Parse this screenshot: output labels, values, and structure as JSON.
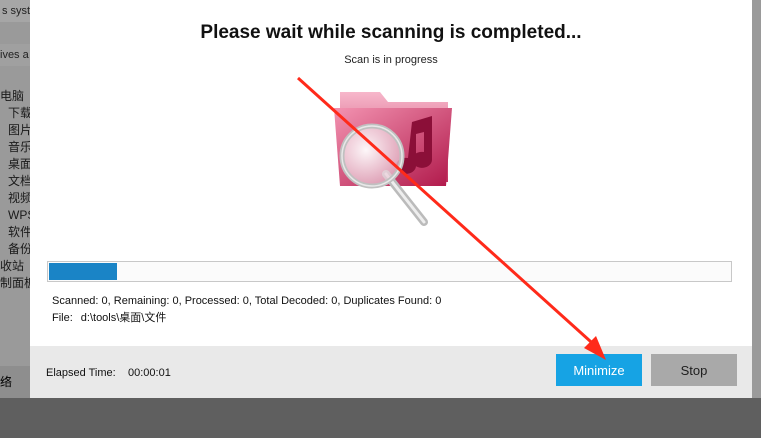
{
  "background": {
    "top_strip_text": "s syst",
    "drive_text": "ives a",
    "tree_items": [
      "电脑",
      "下载",
      "图片",
      "音乐",
      "桌面",
      "文档",
      "视频",
      "WPS",
      "软件",
      "备份",
      "收站",
      "制面板"
    ],
    "bottom_item": "络"
  },
  "dialog": {
    "title": "Please wait while scanning is completed...",
    "subtitle": "Scan is in progress",
    "icon": "music-folder-search-icon",
    "progress_percent": 10,
    "stats": "Scanned: 0, Remaining: 0, Processed: 0, Total Decoded: 0, Duplicates Found: 0",
    "file_label": "File:",
    "file_path": "d:\\tools\\桌面\\文件",
    "elapsed_label": "Elapsed Time:",
    "elapsed_value": "00:00:01",
    "minimize_label": "Minimize",
    "stop_label": "Stop"
  },
  "colors": {
    "accent": "#16a3e4",
    "progress": "#1a84c6",
    "annotation_arrow": "#ff2a1a"
  }
}
